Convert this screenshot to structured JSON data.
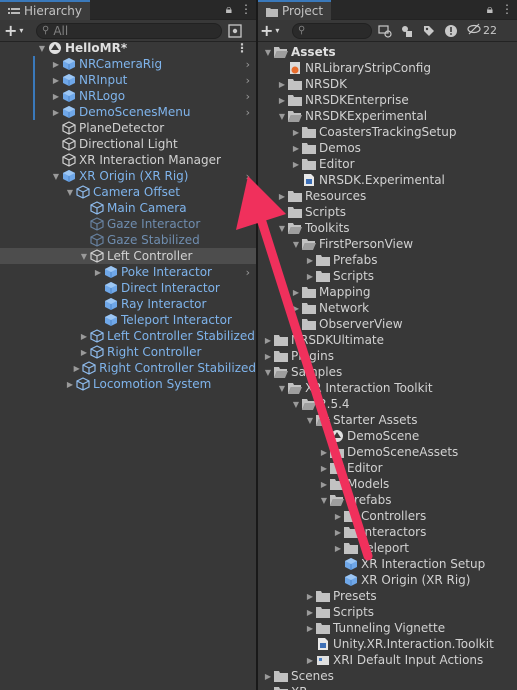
{
  "hierarchy": {
    "tab_label": "Hierarchy",
    "search_placeholder": "All",
    "scene": "HelloMR*",
    "items": [
      {
        "label": "NRCameraRig",
        "icon": "prefab-icon",
        "style": "blue",
        "depth": 1,
        "expand": true,
        "chev": true,
        "bar": true
      },
      {
        "label": "NRInput",
        "icon": "prefab-icon",
        "style": "blue",
        "depth": 1,
        "expand": true,
        "chev": true,
        "bar": true
      },
      {
        "label": "NRLogo",
        "icon": "prefab-icon",
        "style": "blue",
        "depth": 1,
        "expand": true,
        "chev": true,
        "bar": true
      },
      {
        "label": "DemoScenesMenu",
        "icon": "prefab-icon",
        "style": "blue",
        "depth": 1,
        "expand": true,
        "chev": true,
        "bar": true
      },
      {
        "label": "PlaneDetector",
        "icon": "gameobject-icon",
        "style": "gray",
        "depth": 1,
        "expand": false
      },
      {
        "label": "Directional Light",
        "icon": "gameobject-icon",
        "style": "gray",
        "depth": 1,
        "expand": false
      },
      {
        "label": "XR Interaction Manager",
        "icon": "gameobject-icon",
        "style": "gray",
        "depth": 1,
        "expand": false
      },
      {
        "label": "XR Origin (XR Rig)",
        "icon": "prefab-icon",
        "style": "blue",
        "depth": 1,
        "expand": "open",
        "chev": true
      },
      {
        "label": "Camera Offset",
        "icon": "gameobject-blue-icon",
        "style": "blue",
        "depth": 2,
        "expand": "open"
      },
      {
        "label": "Main Camera",
        "icon": "gameobject-blue-icon",
        "style": "blue",
        "depth": 3,
        "expand": false
      },
      {
        "label": "Gaze Interactor",
        "icon": "gameobject-dim-icon",
        "style": "dim",
        "depth": 3,
        "expand": false
      },
      {
        "label": "Gaze Stabilized",
        "icon": "gameobject-dim-icon",
        "style": "dim",
        "depth": 3,
        "expand": false
      },
      {
        "label": "Left Controller",
        "icon": "gameobject-icon",
        "style": "gray",
        "depth": 3,
        "expand": "open",
        "selected": true
      },
      {
        "label": "Poke Interactor",
        "icon": "prefab-icon",
        "style": "blue",
        "depth": 4,
        "expand": true,
        "chev": true
      },
      {
        "label": "Direct Interactor",
        "icon": "prefab-icon",
        "style": "blue",
        "depth": 4,
        "expand": false
      },
      {
        "label": "Ray Interactor",
        "icon": "prefab-icon",
        "style": "blue",
        "depth": 4,
        "expand": false
      },
      {
        "label": "Teleport Interactor",
        "icon": "prefab-icon",
        "style": "blue",
        "depth": 4,
        "expand": false
      },
      {
        "label": "Left Controller Stabilized",
        "icon": "gameobject-blue-icon",
        "style": "blue",
        "depth": 3,
        "expand": true
      },
      {
        "label": "Right Controller",
        "icon": "gameobject-blue-icon",
        "style": "blue",
        "depth": 3,
        "expand": true
      },
      {
        "label": "Right Controller Stabilized",
        "icon": "gameobject-blue-icon",
        "style": "blue",
        "depth": 3,
        "expand": true
      },
      {
        "label": "Locomotion System",
        "icon": "gameobject-blue-icon",
        "style": "blue",
        "depth": 2,
        "expand": true
      }
    ]
  },
  "project": {
    "tab_label": "Project",
    "hidden_count": "22",
    "items": [
      {
        "label": "Assets",
        "icon": "folder-open-icon",
        "depth": 0,
        "expand": "open",
        "bold": true
      },
      {
        "label": "NRLibraryStripConfig",
        "icon": "asset-config-icon",
        "depth": 1,
        "expand": false
      },
      {
        "label": "NRSDK",
        "icon": "folder-icon",
        "depth": 1,
        "expand": true
      },
      {
        "label": "NRSDKEnterprise",
        "icon": "folder-icon",
        "depth": 1,
        "expand": true
      },
      {
        "label": "NRSDKExperimental",
        "icon": "folder-open-icon",
        "depth": 1,
        "expand": "open"
      },
      {
        "label": "CoastersTrackingSetup",
        "icon": "folder-icon",
        "depth": 2,
        "expand": true
      },
      {
        "label": "Demos",
        "icon": "folder-icon",
        "depth": 2,
        "expand": true
      },
      {
        "label": "Editor",
        "icon": "folder-icon",
        "depth": 2,
        "expand": true
      },
      {
        "label": "NRSDK.Experimental",
        "icon": "asmdef-icon",
        "depth": 2,
        "expand": false
      },
      {
        "label": "Resources",
        "icon": "folder-icon",
        "depth": 1,
        "expand": true
      },
      {
        "label": "Scripts",
        "icon": "folder-icon",
        "depth": 1,
        "expand": true
      },
      {
        "label": "Toolkits",
        "icon": "folder-open-icon",
        "depth": 1,
        "expand": "open"
      },
      {
        "label": "FirstPersonView",
        "icon": "folder-open-icon",
        "depth": 2,
        "expand": "open"
      },
      {
        "label": "Prefabs",
        "icon": "folder-icon",
        "depth": 3,
        "expand": true
      },
      {
        "label": "Scripts",
        "icon": "folder-icon",
        "depth": 3,
        "expand": true
      },
      {
        "label": "Mapping",
        "icon": "folder-icon",
        "depth": 2,
        "expand": true
      },
      {
        "label": "Network",
        "icon": "folder-icon",
        "depth": 2,
        "expand": true
      },
      {
        "label": "ObserverView",
        "icon": "folder-icon",
        "depth": 2,
        "expand": true
      },
      {
        "label": "NRSDKUltimate",
        "icon": "folder-icon",
        "depth": 0,
        "expand": true
      },
      {
        "label": "Plugins",
        "icon": "folder-icon",
        "depth": 0,
        "expand": true
      },
      {
        "label": "Samples",
        "icon": "folder-open-icon",
        "depth": 0,
        "expand": "open"
      },
      {
        "label": "XR Interaction Toolkit",
        "icon": "folder-open-icon",
        "depth": 1,
        "expand": "open"
      },
      {
        "label": "2.5.4",
        "icon": "folder-open-icon",
        "depth": 2,
        "expand": "open"
      },
      {
        "label": "Starter Assets",
        "icon": "folder-open-icon",
        "depth": 3,
        "expand": "open"
      },
      {
        "label": "DemoScene",
        "icon": "unity-scene-icon",
        "depth": 4,
        "expand": false
      },
      {
        "label": "DemoSceneAssets",
        "icon": "folder-icon",
        "depth": 4,
        "expand": true
      },
      {
        "label": "Editor",
        "icon": "folder-icon",
        "depth": 4,
        "expand": true
      },
      {
        "label": "Models",
        "icon": "folder-icon",
        "depth": 4,
        "expand": true
      },
      {
        "label": "Prefabs",
        "icon": "folder-open-icon",
        "depth": 4,
        "expand": "open"
      },
      {
        "label": "Controllers",
        "icon": "folder-icon",
        "depth": 5,
        "expand": true
      },
      {
        "label": "Interactors",
        "icon": "folder-icon",
        "depth": 5,
        "expand": true
      },
      {
        "label": "Teleport",
        "icon": "folder-icon",
        "depth": 5,
        "expand": true
      },
      {
        "label": "XR Interaction Setup",
        "icon": "prefab-icon",
        "depth": 5,
        "expand": false
      },
      {
        "label": "XR Origin (XR Rig)",
        "icon": "prefab-icon",
        "depth": 5,
        "expand": false
      },
      {
        "label": "Presets",
        "icon": "folder-icon",
        "depth": 3,
        "expand": true
      },
      {
        "label": "Scripts",
        "icon": "folder-icon",
        "depth": 3,
        "expand": true
      },
      {
        "label": "Tunneling Vignette",
        "icon": "folder-icon",
        "depth": 3,
        "expand": true
      },
      {
        "label": "Unity.XR.Interaction.Toolkit",
        "icon": "asmdef-icon",
        "depth": 3,
        "expand": false
      },
      {
        "label": "XRI Default Input Actions",
        "icon": "input-actions-icon",
        "depth": 3,
        "expand": true
      },
      {
        "label": "Scenes",
        "icon": "folder-icon",
        "depth": 0,
        "expand": true
      },
      {
        "label": "XR",
        "icon": "folder-icon",
        "depth": 0,
        "expand": true
      }
    ]
  },
  "annotation": {
    "type": "arrow",
    "color": "#f0305c"
  }
}
